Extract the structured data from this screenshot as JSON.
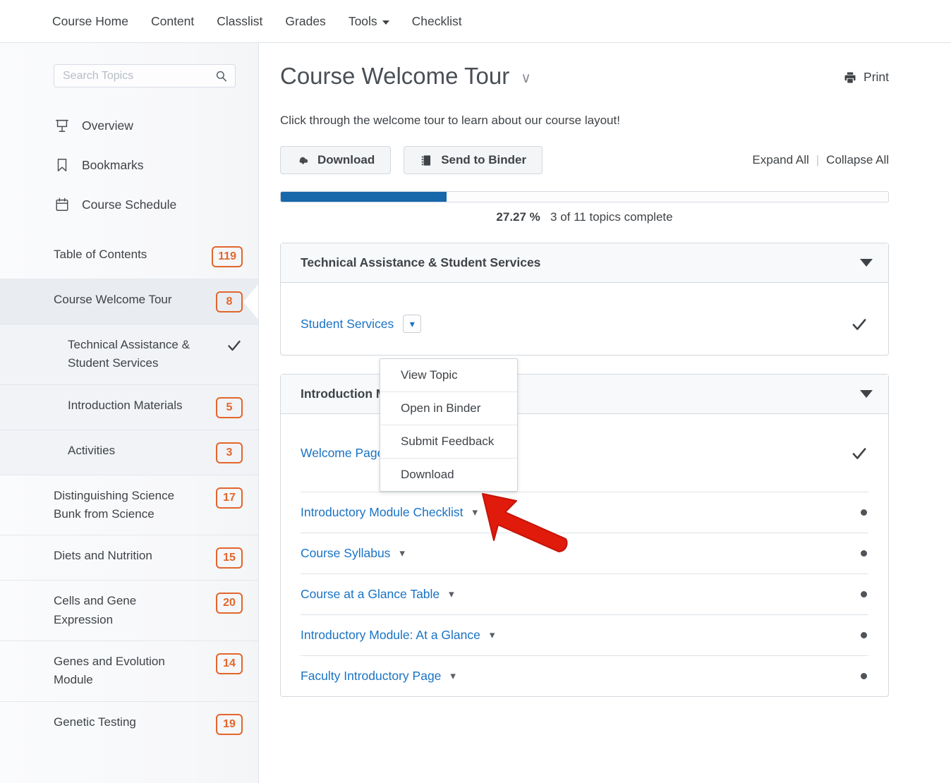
{
  "topnav": {
    "items": [
      {
        "label": "Course Home",
        "has_caret": false
      },
      {
        "label": "Content",
        "has_caret": false
      },
      {
        "label": "Classlist",
        "has_caret": false
      },
      {
        "label": "Grades",
        "has_caret": false
      },
      {
        "label": "Tools",
        "has_caret": true
      },
      {
        "label": "Checklist",
        "has_caret": false
      }
    ]
  },
  "sidebar": {
    "search": {
      "value": "",
      "placeholder": "Search Topics",
      "icon": "search-icon"
    },
    "nav": [
      {
        "label": "Overview",
        "icon": "presentation-icon"
      },
      {
        "label": "Bookmarks",
        "icon": "bookmark-icon"
      },
      {
        "label": "Course Schedule",
        "icon": "calendar-icon"
      }
    ],
    "toc": [
      {
        "label": "Table of Contents",
        "badge": "119",
        "selected": false
      },
      {
        "label": "Course Welcome Tour",
        "badge": "8",
        "selected": true
      },
      {
        "label": "Distinguishing Science Bunk from Science",
        "badge": "17",
        "selected": false
      },
      {
        "label": "Diets and Nutrition",
        "badge": "15",
        "selected": false
      },
      {
        "label": "Cells and Gene Expression",
        "badge": "20",
        "selected": false
      },
      {
        "label": "Genes and Evolution Module",
        "badge": "14",
        "selected": false
      },
      {
        "label": "Genetic Testing",
        "badge": "19",
        "selected": false
      }
    ],
    "sub_items": [
      {
        "label": "Technical Assistance & Student Services",
        "badge": null,
        "status": "check"
      },
      {
        "label": "Introduction Materials",
        "badge": "5",
        "status": null
      },
      {
        "label": "Activities",
        "badge": "3",
        "status": null
      }
    ],
    "badge_color": "#e2662c"
  },
  "main": {
    "title": "Course Welcome Tour",
    "title_chevron": "∨",
    "print_label": "Print",
    "print_icon": "printer-icon",
    "subtitle": "Click through the welcome tour to learn about our course layout!",
    "buttons": [
      {
        "label": "Download",
        "icon": "cloud-download-icon"
      },
      {
        "label": "Send to Binder",
        "icon": "binder-icon"
      }
    ],
    "expand_all": "Expand All",
    "separator": "|",
    "collapse_all": "Collapse All",
    "progress": {
      "percent_value": 27.27,
      "percent_label": "27.27 %",
      "detail": "3 of 11 topics complete",
      "fill_color": "#1767ab"
    },
    "modules": [
      {
        "title": "Technical Assistance & Student Services",
        "expanded": true,
        "topics": [
          {
            "label": "Student Services",
            "status": "check",
            "menu_open": true
          }
        ]
      },
      {
        "title": "Introduction Materials",
        "expanded": true,
        "topics": [
          {
            "label": "Welcome Page",
            "status": "check",
            "menu_open": false
          },
          {
            "label": "Introductory Module Checklist",
            "status": "dot",
            "menu_open": false
          },
          {
            "label": "Course Syllabus",
            "status": "dot",
            "menu_open": false
          },
          {
            "label": "Course at a Glance Table",
            "status": "dot",
            "menu_open": false
          },
          {
            "label": "Introductory Module: At a Glance",
            "status": "dot",
            "menu_open": false
          },
          {
            "label": "Faculty Introductory Page",
            "status": "dot",
            "menu_open": false
          }
        ]
      }
    ],
    "dropdown_menu": {
      "items": [
        "View Topic",
        "Open in Binder",
        "Submit Feedback",
        "Download"
      ]
    },
    "annotation": {
      "type": "arrow",
      "color": "#e01b0c",
      "points_to": "Download"
    },
    "link_color": "#1a73c4"
  }
}
